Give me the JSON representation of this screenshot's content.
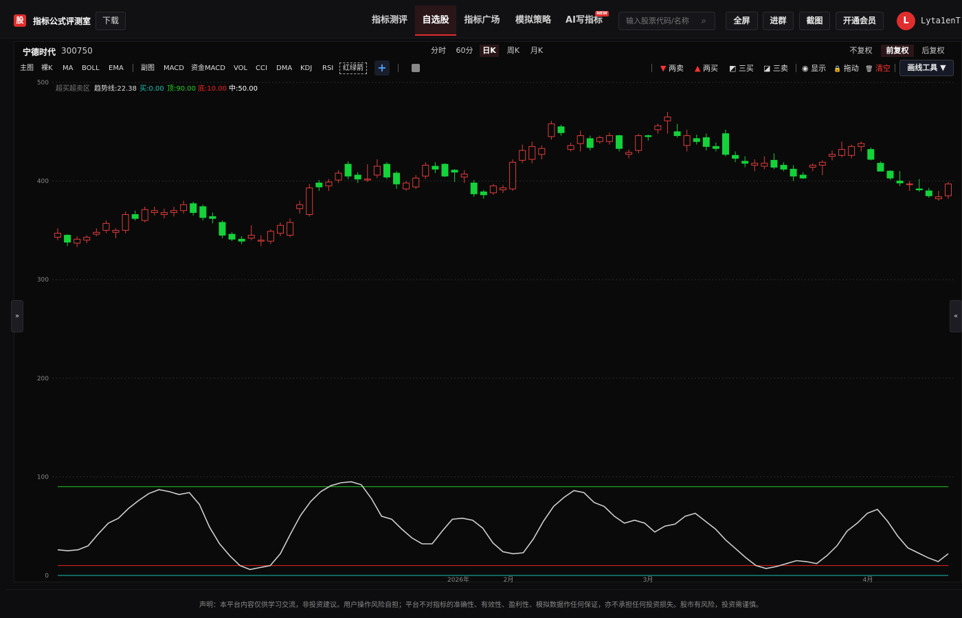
{
  "app": {
    "logo_char": "股",
    "title": "指标公式评测室",
    "download_label": "下载"
  },
  "nav": [
    {
      "label": "指标测评",
      "active": false
    },
    {
      "label": "自选股",
      "active": true
    },
    {
      "label": "指标广场",
      "active": false
    },
    {
      "label": "模拟策略",
      "active": false
    },
    {
      "label": "AI写指标",
      "active": false
    }
  ],
  "nav_badge": "NEW",
  "search": {
    "placeholder": "输入股票代码/名称"
  },
  "toolbar": {
    "fullscreen": "全屏",
    "group": "进群",
    "screenshot": "截图",
    "vip": "开通会员"
  },
  "user": {
    "initial": "L",
    "name": "Lyta1enT"
  },
  "stock": {
    "name": "宁德时代",
    "code": "300750"
  },
  "periods": [
    {
      "label": "分时",
      "active": false
    },
    {
      "label": "60分",
      "active": false
    },
    {
      "label": "日K",
      "active": true
    },
    {
      "label": "周K",
      "active": false
    },
    {
      "label": "月K",
      "active": false
    }
  ],
  "adjust": [
    {
      "label": "不复权",
      "active": false
    },
    {
      "label": "前复权",
      "active": true
    },
    {
      "label": "后复权",
      "active": false
    }
  ],
  "indicators_main": [
    "主图",
    "裸K",
    "MA",
    "BOLL",
    "EMA"
  ],
  "indicators_sub": [
    "副图",
    "MACD",
    "资金MACD",
    "VOL",
    "CCI",
    "DMA",
    "KDJ",
    "RSI"
  ],
  "indicator_boxed": "红绿箭",
  "tools": [
    {
      "icon": "▼",
      "label": "两卖",
      "color": "#ff3333"
    },
    {
      "icon": "▲",
      "label": "两买",
      "color": "#ff3333"
    },
    {
      "icon": "◩",
      "label": "三买",
      "color": "#dddddd"
    },
    {
      "icon": "◪",
      "label": "三卖",
      "color": "#dddddd"
    },
    {
      "icon": "◉",
      "label": "显示",
      "color": "#dddddd"
    },
    {
      "icon": "🔒",
      "label": "拖动",
      "color": "#f0c040"
    },
    {
      "icon": "🗑",
      "label": "清空",
      "color": "#ff3333"
    }
  ],
  "draw_tools_label": "画线工具 ▼",
  "side_left": "»",
  "side_right": "«",
  "legend": {
    "name": "超买超卖区",
    "items": [
      {
        "label": "趋势线:22.38",
        "color": "#dddddd"
      },
      {
        "label": "买:0.00",
        "color": "#18c0b0"
      },
      {
        "label": "顶:90.00",
        "color": "#22cc22"
      },
      {
        "label": "底:10.00",
        "color": "#ee2222"
      },
      {
        "label": "中:50.00",
        "color": "#ffffff"
      }
    ]
  },
  "chart_data": {
    "type": "candlestick",
    "y_ticks": [
      0,
      100,
      200,
      300,
      400,
      500
    ],
    "ylim": [
      0,
      500
    ],
    "x_ticks": [
      "2026年",
      "2月",
      "3月",
      "4月"
    ],
    "colors": {
      "up": "#e23c3c",
      "down": "#14d23a",
      "trend": "#cfcfcf",
      "top": "#22cc22",
      "bottom": "#ee2222",
      "buy": "#18c0b0"
    },
    "reference_lines": {
      "top": 90,
      "bottom": 10,
      "buy": 0
    },
    "candles": [
      [
        343,
        352,
        340,
        347
      ],
      [
        345,
        346,
        334,
        338
      ],
      [
        337,
        344,
        333,
        341
      ],
      [
        340,
        345,
        337,
        343
      ],
      [
        346,
        352,
        344,
        348
      ],
      [
        350,
        360,
        347,
        357
      ],
      [
        348,
        352,
        342,
        350
      ],
      [
        350,
        369,
        347,
        366
      ],
      [
        366,
        370,
        360,
        362
      ],
      [
        360,
        374,
        358,
        371
      ],
      [
        368,
        374,
        365,
        370
      ],
      [
        366,
        372,
        362,
        368
      ],
      [
        368,
        374,
        364,
        370
      ],
      [
        370,
        380,
        367,
        376
      ],
      [
        377,
        379,
        365,
        368
      ],
      [
        374,
        376,
        360,
        363
      ],
      [
        364,
        368,
        357,
        362
      ],
      [
        358,
        360,
        342,
        345
      ],
      [
        346,
        348,
        339,
        341
      ],
      [
        341,
        344,
        336,
        339
      ],
      [
        342,
        355,
        340,
        345
      ],
      [
        339,
        345,
        334,
        340
      ],
      [
        339,
        351,
        336,
        349
      ],
      [
        347,
        358,
        344,
        355
      ],
      [
        345,
        362,
        343,
        358
      ],
      [
        372,
        380,
        367,
        376
      ],
      [
        366,
        397,
        364,
        393
      ],
      [
        398,
        401,
        390,
        394
      ],
      [
        395,
        402,
        390,
        399
      ],
      [
        401,
        411,
        398,
        408
      ],
      [
        417,
        420,
        402,
        405
      ],
      [
        406,
        409,
        398,
        402
      ],
      [
        401,
        417,
        399,
        402
      ],
      [
        406,
        422,
        403,
        415
      ],
      [
        417,
        419,
        402,
        404
      ],
      [
        408,
        410,
        392,
        397
      ],
      [
        392,
        400,
        390,
        398
      ],
      [
        394,
        406,
        392,
        403
      ],
      [
        405,
        419,
        402,
        416
      ],
      [
        415,
        419,
        408,
        412
      ],
      [
        417,
        418,
        404,
        405
      ],
      [
        411,
        412,
        399,
        409
      ],
      [
        404,
        411,
        398,
        407
      ],
      [
        398,
        401,
        384,
        387
      ],
      [
        389,
        391,
        382,
        386
      ],
      [
        388,
        397,
        386,
        395
      ],
      [
        391,
        396,
        388,
        393
      ],
      [
        392,
        422,
        390,
        419
      ],
      [
        421,
        437,
        418,
        431
      ],
      [
        422,
        440,
        418,
        435
      ],
      [
        427,
        436,
        422,
        433
      ],
      [
        445,
        461,
        442,
        458
      ],
      [
        455,
        457,
        446,
        449
      ],
      [
        432,
        439,
        430,
        436
      ],
      [
        438,
        451,
        430,
        446
      ],
      [
        443,
        446,
        431,
        434
      ],
      [
        440,
        446,
        438,
        444
      ],
      [
        440,
        449,
        437,
        446
      ],
      [
        446,
        447,
        430,
        433
      ],
      [
        427,
        432,
        423,
        429
      ],
      [
        431,
        448,
        428,
        446
      ],
      [
        446,
        447,
        441,
        445
      ],
      [
        452,
        458,
        448,
        456
      ],
      [
        461,
        470,
        448,
        465
      ],
      [
        450,
        458,
        444,
        446
      ],
      [
        436,
        452,
        430,
        446
      ],
      [
        443,
        447,
        437,
        440
      ],
      [
        444,
        448,
        431,
        435
      ],
      [
        435,
        439,
        430,
        433
      ],
      [
        448,
        452,
        425,
        427
      ],
      [
        426,
        430,
        419,
        423
      ],
      [
        420,
        425,
        414,
        418
      ],
      [
        416,
        422,
        410,
        418
      ],
      [
        415,
        425,
        412,
        418
      ],
      [
        421,
        428,
        412,
        414
      ],
      [
        416,
        419,
        410,
        412
      ],
      [
        412,
        416,
        400,
        405
      ],
      [
        406,
        409,
        402,
        403
      ],
      [
        414,
        418,
        410,
        416
      ],
      [
        416,
        421,
        406,
        419
      ],
      [
        425,
        431,
        421,
        427
      ],
      [
        426,
        440,
        424,
        432
      ],
      [
        426,
        437,
        423,
        435
      ],
      [
        435,
        440,
        430,
        438
      ],
      [
        432,
        434,
        421,
        422
      ],
      [
        418,
        420,
        410,
        410
      ],
      [
        410,
        411,
        401,
        403
      ],
      [
        400,
        410,
        395,
        398
      ],
      [
        397,
        400,
        390,
        397
      ],
      [
        392,
        402,
        389,
        391
      ],
      [
        390,
        393,
        383,
        385
      ],
      [
        382,
        390,
        380,
        384
      ],
      [
        385,
        399,
        382,
        397
      ]
    ],
    "trend": [
      26,
      25,
      26,
      30,
      42,
      53,
      58,
      68,
      76,
      83,
      87,
      85,
      82,
      84,
      72,
      49,
      32,
      20,
      10,
      6,
      8,
      10,
      22,
      42,
      61,
      75,
      85,
      91,
      94,
      95,
      92,
      78,
      60,
      57,
      47,
      38,
      32,
      32,
      45,
      57,
      58,
      56,
      48,
      33,
      24,
      22,
      23,
      37,
      55,
      70,
      79,
      86,
      84,
      74,
      70,
      60,
      53,
      56,
      53,
      44,
      50,
      52,
      60,
      63,
      55,
      47,
      36,
      27,
      18,
      10,
      7,
      9,
      12,
      15,
      14,
      12,
      20,
      30,
      45,
      53,
      63,
      67,
      55,
      40,
      28,
      23,
      18,
      14,
      22
    ]
  },
  "footer": "声明：本平台内容仅供学习交流，非投资建议。用户操作风险自担；平台不对指标的准确性、有效性、盈利性、模拟数据作任何保证，亦不承担任何投资损失。股市有风险，投资需谨慎。"
}
